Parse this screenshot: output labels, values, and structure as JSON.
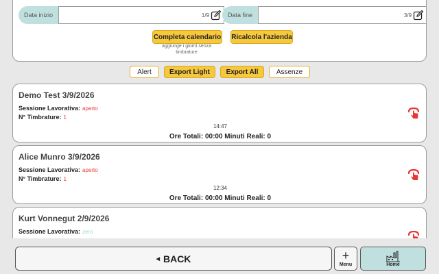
{
  "filters": {
    "start_label": "Data inizio",
    "start_value": "1/9",
    "end_label": "Data fine",
    "end_value": "3/9"
  },
  "actions": {
    "complete_calendar": "Completa calendario",
    "complete_hint": "aggiunge i giorni senza timbrature",
    "recalc_company": "Ricalcola l'azienda"
  },
  "export": {
    "alert": "Alert",
    "export_light": "Export Light",
    "export_all": "Export All",
    "absences": "Assenze"
  },
  "labels": {
    "session": "Sessione Lavorativa:",
    "punches": "N° Timbrature:"
  },
  "sessions": [
    {
      "title": "Demo Test 3/9/2026",
      "status": "aperto",
      "punches": "1",
      "time": "14:47",
      "totals": "Ore Totali: 00:00 Minuti Reali: 0"
    },
    {
      "title": "Alice Munro 3/9/2026",
      "status": "aperto",
      "punches": "1",
      "time": "12:34",
      "totals": "Ore Totali: 00:00 Minuti Reali: 0"
    },
    {
      "title": "Kurt Vonnegut 2/9/2026",
      "status": "zero",
      "punches": "",
      "time": "",
      "totals": ""
    }
  ],
  "footer": {
    "back": "BACK",
    "menu": "Menu",
    "home": "Home"
  },
  "colors": {
    "accent_yellow": "#f6c83e",
    "teal": "#bfe0df",
    "status_red": "#e53935",
    "status_teal": "#9fd6d4"
  },
  "icons": {
    "edit": "edit-icon",
    "hand": "tap-hand-icon",
    "back": "caret-left-icon",
    "menu": "plus-icon",
    "home": "factory-icon"
  }
}
